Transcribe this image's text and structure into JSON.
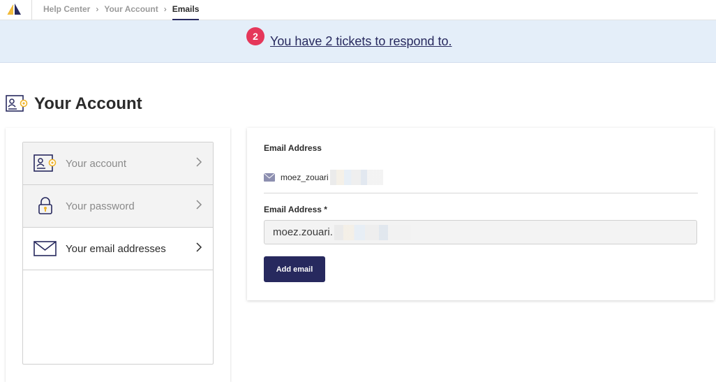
{
  "nav": {
    "breadcrumbs": [
      "Help Center",
      "Your Account",
      "Emails"
    ]
  },
  "banner": {
    "badge_count": "2",
    "link_text": "You have 2 tickets to respond to."
  },
  "page": {
    "title": "Your Account"
  },
  "sidebar": {
    "items": [
      {
        "label": "Your account",
        "icon": "account-card-icon",
        "active": false
      },
      {
        "label": "Your password",
        "icon": "lock-icon",
        "active": false
      },
      {
        "label": "Your email addresses",
        "icon": "envelope-icon",
        "active": true
      }
    ]
  },
  "emails": {
    "existing_label": "Email Address",
    "existing_value": "moez_zouari",
    "new_label": "Email Address *",
    "new_value": "moez.zouari.",
    "add_button": "Add email"
  },
  "colors": {
    "brand_navy": "#27295e",
    "badge_red": "#e5375a",
    "banner_bg": "#e4eef9",
    "icon_accent": "#f0b429"
  }
}
